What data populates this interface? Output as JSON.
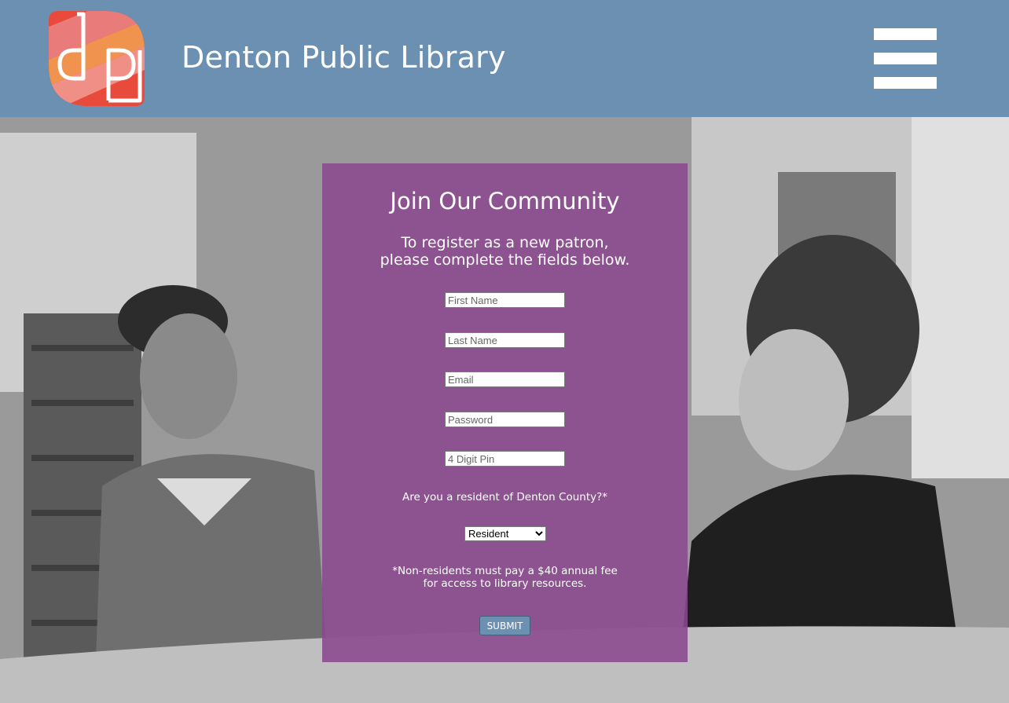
{
  "header": {
    "site_title": "Denton Public Library",
    "logo_letters": "dp",
    "colors": {
      "header_bg": "#6b90b2",
      "logo_red": "#e84a3c",
      "logo_orange": "#f0934f",
      "logo_pink": "#ea7b7b"
    }
  },
  "menu": {
    "icon": "hamburger-menu-icon"
  },
  "form": {
    "title": "Join Our Community",
    "subtitle_line1": "To register as a new patron,",
    "subtitle_line2": "please complete the fields below.",
    "fields": {
      "first_name": {
        "placeholder": "First Name",
        "value": ""
      },
      "last_name": {
        "placeholder": "Last Name",
        "value": ""
      },
      "email": {
        "placeholder": "Email",
        "value": ""
      },
      "password": {
        "placeholder": "Password",
        "value": ""
      },
      "pin": {
        "placeholder": "4 Digit Pin",
        "value": ""
      }
    },
    "residency_question": "Are you a resident of Denton County?*",
    "residency_selected": "Resident",
    "fee_note_line1": "*Non-residents must pay a $40 annual fee",
    "fee_note_line2": "for access to library resources.",
    "submit_label": "SUBMIT",
    "colors": {
      "panel_bg": "#8b488e",
      "button_bg": "#6b90b2"
    }
  }
}
